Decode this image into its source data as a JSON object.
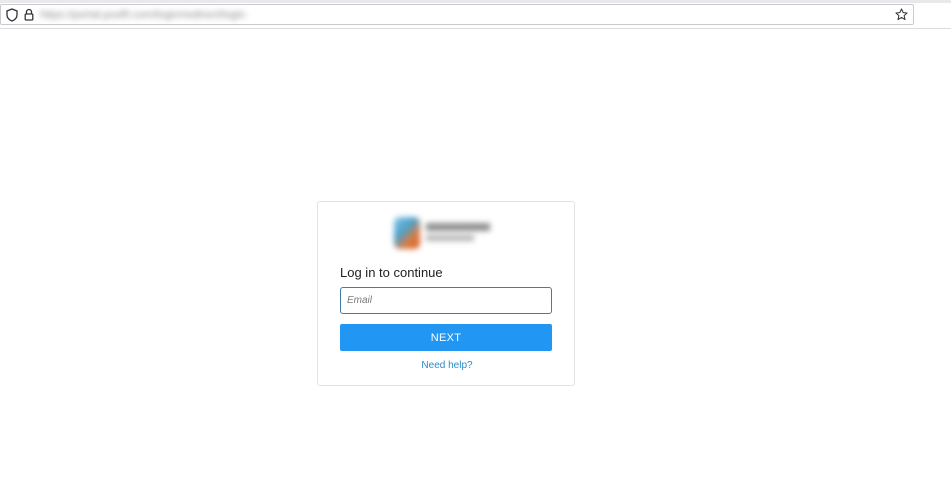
{
  "browser": {
    "url": "https://portal.pcelfi.com/login/redirect/login",
    "icons": {
      "shield": "shield-icon",
      "lock": "lock-icon",
      "bookmark": "star-icon"
    }
  },
  "login": {
    "title": "Log in to continue",
    "email_placeholder": "Email",
    "email_value": "",
    "next_label": "NEXT",
    "help_link": "Need help?"
  },
  "colors": {
    "primary": "#2196f3",
    "link": "#2a8ac8",
    "input_border": "#3d7fa8"
  }
}
